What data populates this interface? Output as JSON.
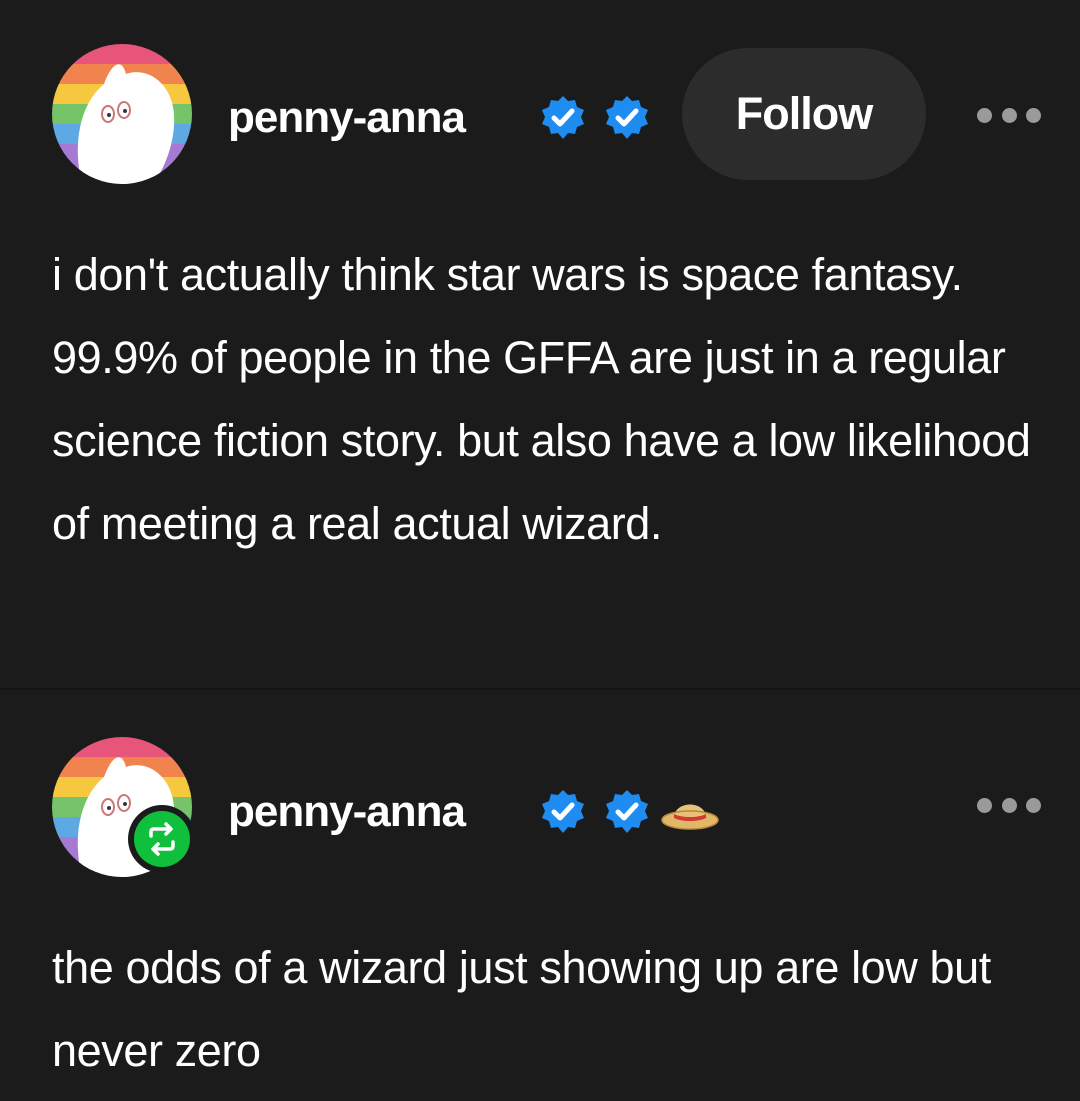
{
  "posts": [
    {
      "username": "penny-anna",
      "follow_label": "Follow",
      "body": "i don't actually think star wars is space fantasy. 99.9% of people in the GFFA are just in a regular science fiction story. but also have a low likelihood of meeting a real actual wizard."
    },
    {
      "username": "penny-anna",
      "body": "the odds of a wizard just showing up are low but never zero"
    }
  ],
  "icons": {
    "verified_badge": "verified-checkmark-icon",
    "reblog_badge": "reblog-icon",
    "hat": "straw-hat-icon",
    "more": "more-options-icon"
  },
  "colors": {
    "background": "#1b1b1b",
    "verified_blue": "#1e8cf0",
    "reblog_green": "#10c03c",
    "follow_button_bg": "#2c2c2c"
  }
}
